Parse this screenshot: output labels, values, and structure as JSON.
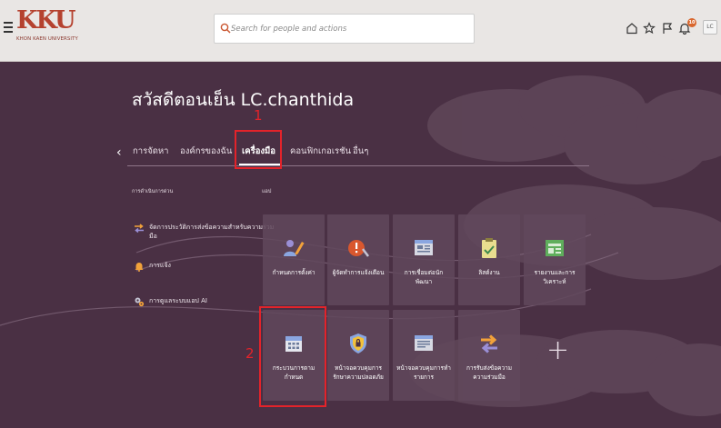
{
  "header": {
    "logo_mark": "KKU",
    "logo_sub": "KHON KAEN UNIVERSITY",
    "search_placeholder": "Search for people and actions",
    "notification_count": "10",
    "avatar_initials": "LC"
  },
  "greeting": "สวัสดีตอนเย็น LC.chanthida",
  "nav": {
    "tabs": [
      {
        "label": "การจัดหา"
      },
      {
        "label": "องค์กรของฉัน"
      },
      {
        "label": "เครื่องมือ",
        "active": true
      },
      {
        "label": "คอนฟิกเกอเรชัน"
      },
      {
        "label": "อื่นๆ"
      }
    ]
  },
  "sections": {
    "quick_actions": "การดำเนินการด่วน",
    "apps": "แอป"
  },
  "quick_actions": [
    {
      "label": "จัดการประวัติการส่งข้อความสำหรับความร่วมมือ",
      "icon": "swap-arrows-icon"
    },
    {
      "label": "การแจ้ง",
      "icon": "bell-icon"
    },
    {
      "label": "การดูแลระบบแอป AI",
      "icon": "gears-icon"
    }
  ],
  "apps": [
    {
      "label": "กำหนดการตั้งค่า",
      "icon": "person-pencil-icon"
    },
    {
      "label": "ผู้จัดทำการแจ้งเตือน",
      "icon": "alert-creator-icon"
    },
    {
      "label": "การเชื่อมต่อนักพัฒนา",
      "icon": "developer-connect-icon"
    },
    {
      "label": "ลิสต์งาน",
      "icon": "task-list-icon"
    },
    {
      "label": "รายงานและการวิเคราะห์",
      "icon": "reports-icon"
    },
    {
      "label": "กระบวนการตามกำหนด",
      "icon": "calendar-icon"
    },
    {
      "label": "หน้าจอควบคุมการรักษาความปลอดภัย",
      "icon": "security-shield-icon"
    },
    {
      "label": "หน้าจอควบคุมการทำรายการ",
      "icon": "transaction-console-icon"
    },
    {
      "label": "การรับส่งข้อความความร่วมมือ",
      "icon": "collaboration-messaging-icon"
    }
  ],
  "annotations": {
    "step1": "1",
    "step2": "2"
  },
  "colors": {
    "background": "#4a3044",
    "header": "#e9e6e4",
    "tile": "#60485c",
    "annotation": "#e3232a",
    "brand": "#b5422f"
  }
}
